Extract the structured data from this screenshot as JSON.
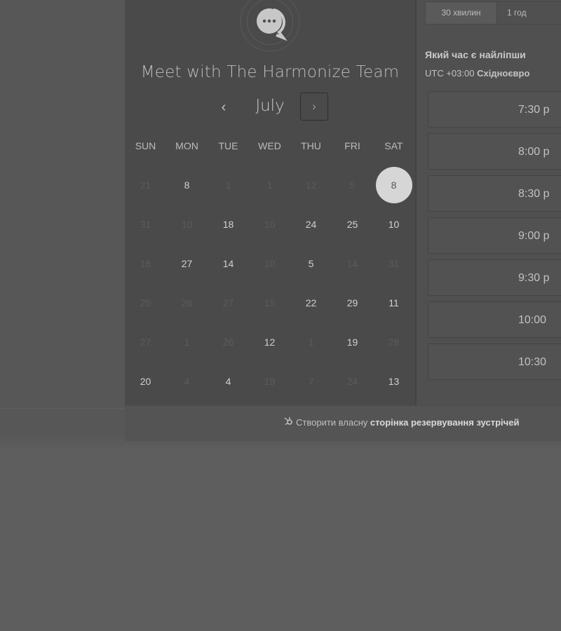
{
  "title": "Meet with The Harmonize Team",
  "calendar": {
    "month": "July",
    "prev_icon": "‹",
    "next_icon": "›",
    "weekdays": [
      "SUN",
      "MON",
      "TUE",
      "WED",
      "THU",
      "FRI",
      "SAT"
    ],
    "weeks": [
      [
        {
          "d": "21",
          "a": false
        },
        {
          "d": "8",
          "a": true
        },
        {
          "d": "1",
          "a": false
        },
        {
          "d": "1",
          "a": false
        },
        {
          "d": "12",
          "a": false
        },
        {
          "d": "5",
          "a": false
        },
        {
          "d": "8",
          "a": true,
          "selected": true
        }
      ],
      [
        {
          "d": "31",
          "a": false
        },
        {
          "d": "10",
          "a": false
        },
        {
          "d": "18",
          "a": true
        },
        {
          "d": "10",
          "a": false
        },
        {
          "d": "24",
          "a": true
        },
        {
          "d": "25",
          "a": true
        },
        {
          "d": "10",
          "a": true
        }
      ],
      [
        {
          "d": "16",
          "a": false
        },
        {
          "d": "27",
          "a": true
        },
        {
          "d": "14",
          "a": true
        },
        {
          "d": "10",
          "a": false
        },
        {
          "d": "5",
          "a": true
        },
        {
          "d": "14",
          "a": false
        },
        {
          "d": "31",
          "a": false
        }
      ],
      [
        {
          "d": "25",
          "a": false
        },
        {
          "d": "26",
          "a": false
        },
        {
          "d": "27",
          "a": false
        },
        {
          "d": "15",
          "a": false
        },
        {
          "d": "22",
          "a": true
        },
        {
          "d": "29",
          "a": true
        },
        {
          "d": "11",
          "a": true
        }
      ],
      [
        {
          "d": "27",
          "a": false
        },
        {
          "d": "1",
          "a": false
        },
        {
          "d": "26",
          "a": false
        },
        {
          "d": "12",
          "a": true
        },
        {
          "d": "1",
          "a": false
        },
        {
          "d": "19",
          "a": true
        },
        {
          "d": "28",
          "a": false
        }
      ],
      [
        {
          "d": "20",
          "a": true
        },
        {
          "d": "4",
          "a": false
        },
        {
          "d": "4",
          "a": true
        },
        {
          "d": "19",
          "a": false
        },
        {
          "d": "7",
          "a": false
        },
        {
          "d": "24",
          "a": false
        },
        {
          "d": "13",
          "a": true
        }
      ]
    ]
  },
  "right": {
    "durations": [
      "30 хвилин",
      "1 год"
    ],
    "prompt": "Який час є найліпши",
    "tz_prefix": "UTC +03:00 ",
    "tz_name": "Східноєвро",
    "slots": [
      "7:30 p",
      "8:00 p",
      "8:30 p",
      "9:00 p",
      "9:30 p",
      "10:00",
      "10:30"
    ]
  },
  "footer": {
    "prefix": "Створити власну ",
    "bold": "сторінка резервування зустрічей",
    "icon": "hubspot-sprocket-icon"
  },
  "colors": {
    "overlay_bg": "#575757",
    "calendar_panel": "#4a4a4a",
    "selected_day": "#d6d6d6"
  }
}
